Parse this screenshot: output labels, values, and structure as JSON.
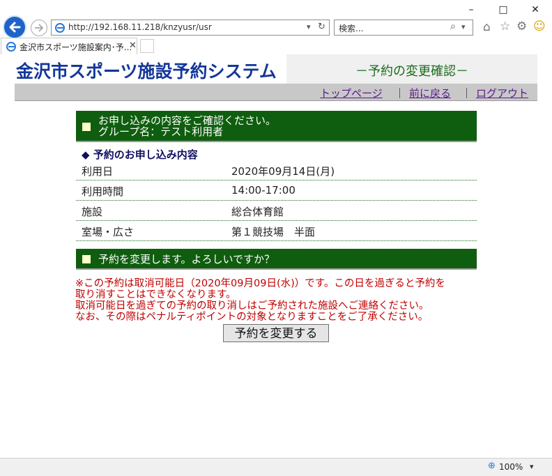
{
  "browser": {
    "url": "http://192.168.11.218/knzyusr/usr",
    "search_placeholder": "検索...",
    "tab_title": "金沢市スポーツ施設案内･予...",
    "zoom": "100%"
  },
  "site": {
    "logo": "金沢市スポーツ施設予約システム",
    "page_title": "－予約の変更確認－",
    "nav": {
      "top": "トップページ",
      "back": "前に戻る",
      "logout": "ログアウト",
      "separator": "｜"
    }
  },
  "confirm": {
    "line1": "お申し込みの内容をご確認ください。",
    "line2": "グループ名：テスト利用者",
    "subhead": "◆ 予約のお申し込み内容",
    "rows": [
      {
        "key": "利用日",
        "value": "2020年09月14日(月)"
      },
      {
        "key": "利用時間",
        "value": "14:00-17:00"
      },
      {
        "key": "施設",
        "value": "総合体育館"
      },
      {
        "key": "室場・広さ",
        "value": "第１競技場　半面"
      }
    ]
  },
  "change": {
    "heading": "予約を変更します。よろしいですか？",
    "warning": [
      "※この予約は取消可能日（2020年09月09日(水)）です。この日を過ぎると予約を",
      "取り消すことはできなくなります。",
      "取消可能日を過ぎての予約の取り消しはご予約された施設へご連絡ください。",
      "なお、その際はペナルティポイントの対象となりますことをご了承ください。"
    ],
    "button": "予約を変更する"
  }
}
